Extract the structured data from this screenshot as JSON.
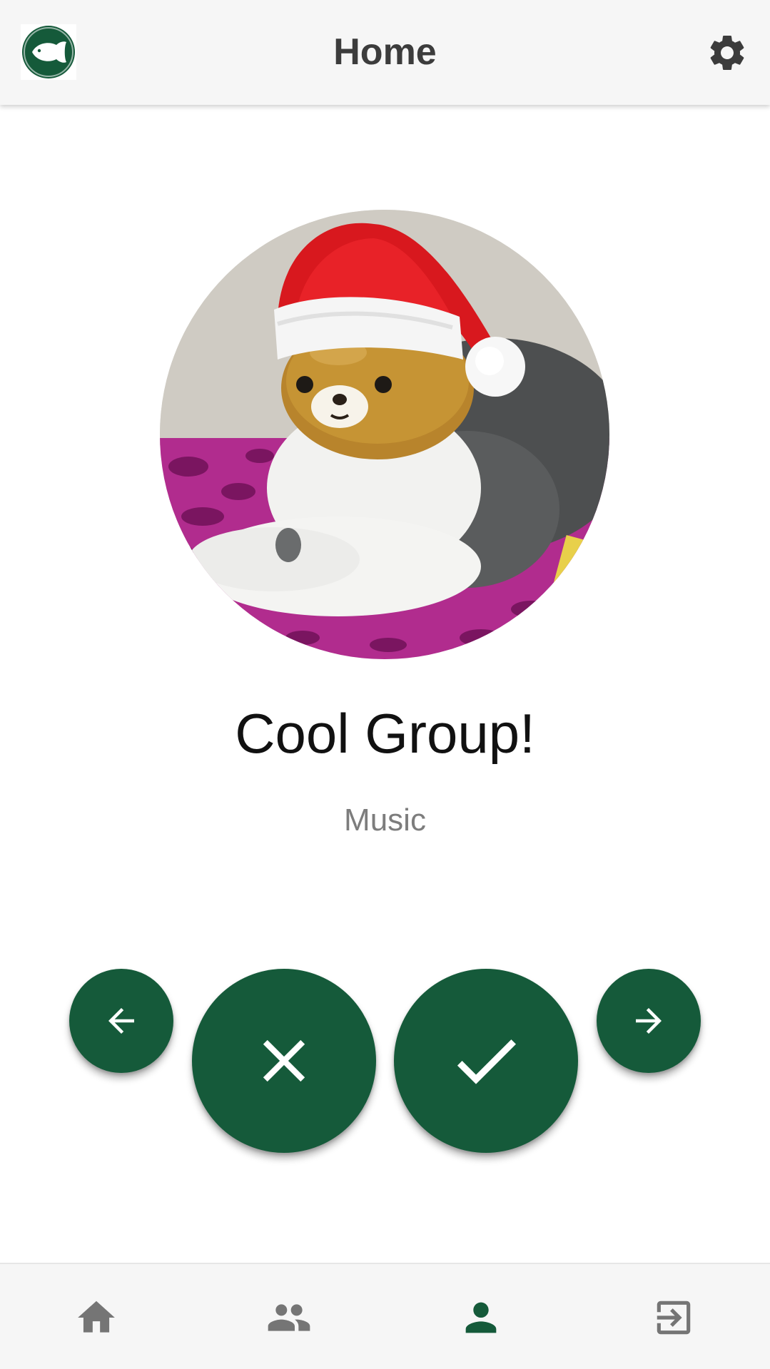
{
  "header": {
    "title": "Home",
    "logo_icon": "fish-logo-icon",
    "settings_icon": "gear-icon"
  },
  "profile": {
    "group_name": "Cool Group!",
    "category": "Music",
    "image": "bear-cat-santa-hat-photo"
  },
  "actions": {
    "previous_icon": "arrow-left-icon",
    "reject_icon": "close-icon",
    "accept_icon": "check-icon",
    "next_icon": "arrow-right-icon"
  },
  "bottom_nav": {
    "items": [
      {
        "icon": "home-icon",
        "active": false
      },
      {
        "icon": "group-icon",
        "active": false
      },
      {
        "icon": "person-icon",
        "active": true
      },
      {
        "icon": "exit-icon",
        "active": false
      }
    ]
  },
  "colors": {
    "primary": "#155a3a",
    "bar_background": "#f6f6f6",
    "icon_inactive": "#757575",
    "title_text": "#3c3c3c",
    "secondary_text": "#7d7d7d"
  }
}
